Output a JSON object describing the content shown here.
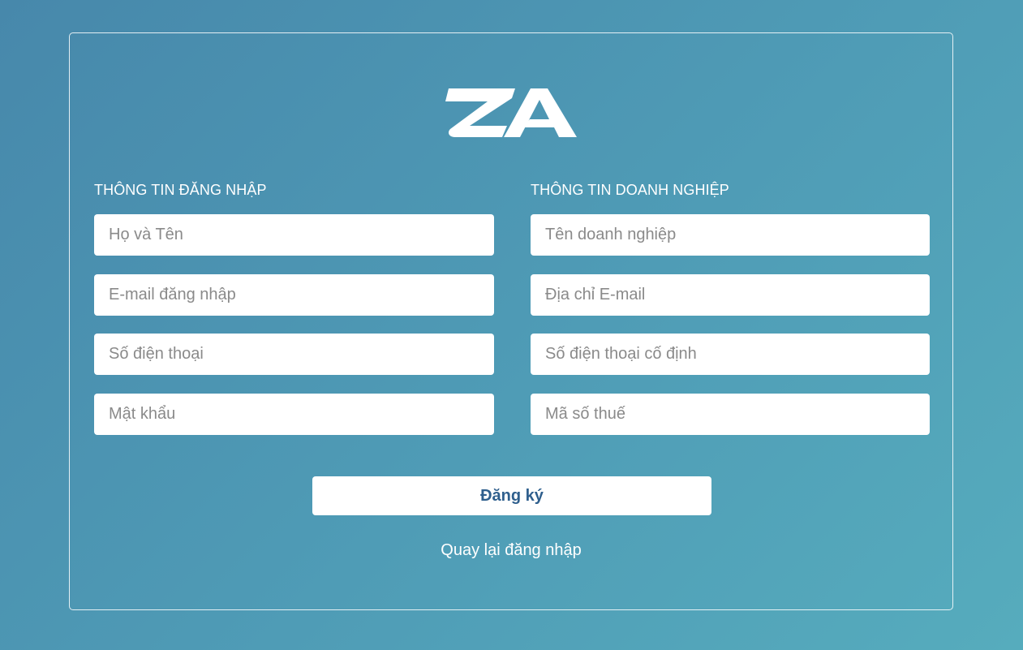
{
  "logo": {
    "text": "ZA",
    "color": "#ffffff"
  },
  "login_info": {
    "title": "THÔNG TIN ĐĂNG NHẬP",
    "fields": [
      {
        "placeholder": "Họ và Tên",
        "value": ""
      },
      {
        "placeholder": "E-mail đăng nhập",
        "value": ""
      },
      {
        "placeholder": "Số điện thoại",
        "value": ""
      },
      {
        "placeholder": "Mật khẩu",
        "value": ""
      }
    ]
  },
  "business_info": {
    "title": "THÔNG TIN DOANH NGHIỆP",
    "fields": [
      {
        "placeholder": "Tên doanh nghiệp",
        "value": ""
      },
      {
        "placeholder": "Địa chỉ E-mail",
        "value": ""
      },
      {
        "placeholder": "Số điện thoại cố định",
        "value": ""
      },
      {
        "placeholder": "Mã số thuế",
        "value": ""
      }
    ]
  },
  "actions": {
    "submit_label": "Đăng ký",
    "back_link": "Quay lại đăng nhập"
  },
  "colors": {
    "background_start": "#4788ab",
    "background_end": "#56acbd",
    "button_text": "#2f5f8d"
  }
}
